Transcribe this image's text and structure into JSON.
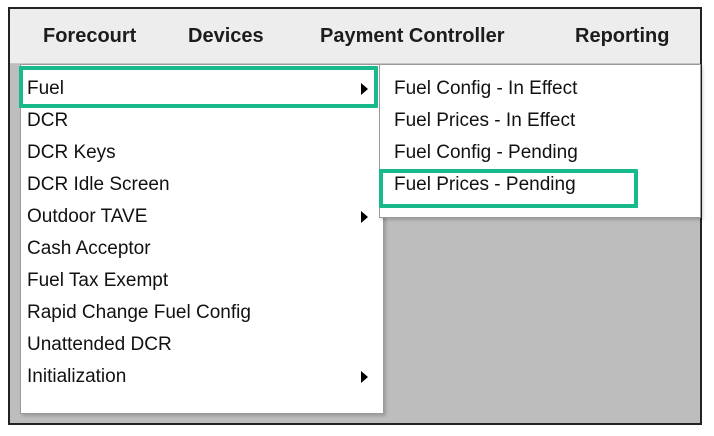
{
  "menubar": {
    "items": [
      {
        "label": "Forecourt"
      },
      {
        "label": "Devices"
      },
      {
        "label": "Payment Controller"
      },
      {
        "label": "Reporting"
      }
    ]
  },
  "forecourt_menu": {
    "items": [
      {
        "label": "Fuel",
        "has_submenu": true
      },
      {
        "label": "DCR",
        "has_submenu": false
      },
      {
        "label": "DCR Keys",
        "has_submenu": false
      },
      {
        "label": "DCR Idle Screen",
        "has_submenu": false
      },
      {
        "label": "Outdoor TAVE",
        "has_submenu": true
      },
      {
        "label": "Cash Acceptor",
        "has_submenu": false
      },
      {
        "label": "Fuel Tax Exempt",
        "has_submenu": false
      },
      {
        "label": "Rapid Change Fuel Config",
        "has_submenu": false
      },
      {
        "label": "Unattended DCR",
        "has_submenu": false
      },
      {
        "label": "Initialization",
        "has_submenu": true
      }
    ]
  },
  "fuel_submenu": {
    "items": [
      {
        "label": "Fuel Config - In Effect"
      },
      {
        "label": "Fuel Prices - In Effect"
      },
      {
        "label": "Fuel Config - Pending"
      },
      {
        "label": "Fuel Prices - Pending"
      }
    ]
  },
  "colors": {
    "highlight": "#18b98a",
    "menubar_bg": "#ededed",
    "workspace_bg": "#bdbdbd",
    "menu_bg": "#ffffff"
  }
}
